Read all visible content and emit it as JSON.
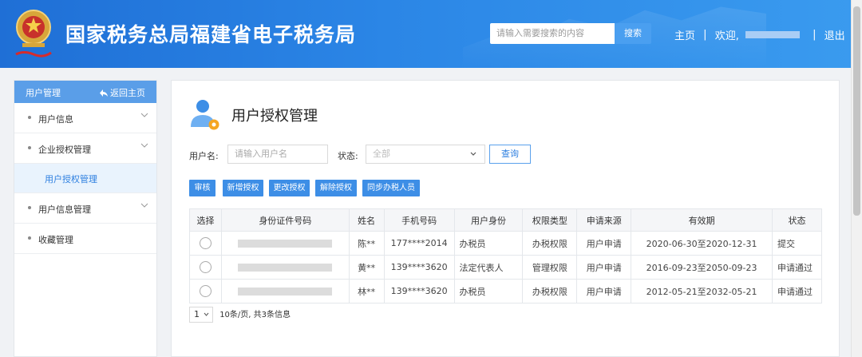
{
  "header": {
    "site_title": "国家税务总局福建省电子税务局",
    "search_placeholder": "请输入需要搜索的内容",
    "search_button": "搜索",
    "home_link": "主页",
    "divider1": "|",
    "welcome": "欢迎,",
    "divider2": "|",
    "logout": "退出"
  },
  "sidebar": {
    "title": "用户管理",
    "back_link": "返回主页",
    "items": [
      {
        "label": "用户信息",
        "expandable": true
      },
      {
        "label": "企业授权管理",
        "expandable": true
      },
      {
        "label": "用户授权管理",
        "sub": true
      },
      {
        "label": "用户信息管理",
        "expandable": true
      },
      {
        "label": "收藏管理",
        "expandable": false
      }
    ]
  },
  "main": {
    "page_title": "用户授权管理",
    "filters": {
      "username_label": "用户名:",
      "username_placeholder": "请输入用户名",
      "status_label": "状态:",
      "status_value": "全部",
      "query_button": "查询"
    },
    "actions": [
      "审核",
      "新增授权",
      "更改授权",
      "解除授权",
      "同步办税人员"
    ],
    "table": {
      "columns": [
        "选择",
        "身份证件号码",
        "姓名",
        "手机号码",
        "用户身份",
        "权限类型",
        "申请来源",
        "有效期",
        "状态"
      ],
      "rows": [
        {
          "name": "陈**",
          "phone": "177****2014",
          "identity": "办税员",
          "perm": "办税权限",
          "source": "用户申请",
          "validity": "2020-06-30至2020-12-31",
          "status": "提交"
        },
        {
          "name": "黄**",
          "phone": "139****3620",
          "identity": "法定代表人",
          "perm": "管理权限",
          "source": "用户申请",
          "validity": "2016-09-23至2050-09-23",
          "status": "申请通过"
        },
        {
          "name": "林**",
          "phone": "139****3620",
          "identity": "办税员",
          "perm": "办税权限",
          "source": "用户申请",
          "validity": "2012-05-21至2032-05-21",
          "status": "申请通过"
        }
      ]
    },
    "pager": {
      "page": "1",
      "info": "10条/页, 共3条信息"
    }
  },
  "colors": {
    "header_blue": "#2b86e6",
    "accent_blue": "#3d8ee6",
    "sidebar_head": "#5a9ee8"
  }
}
